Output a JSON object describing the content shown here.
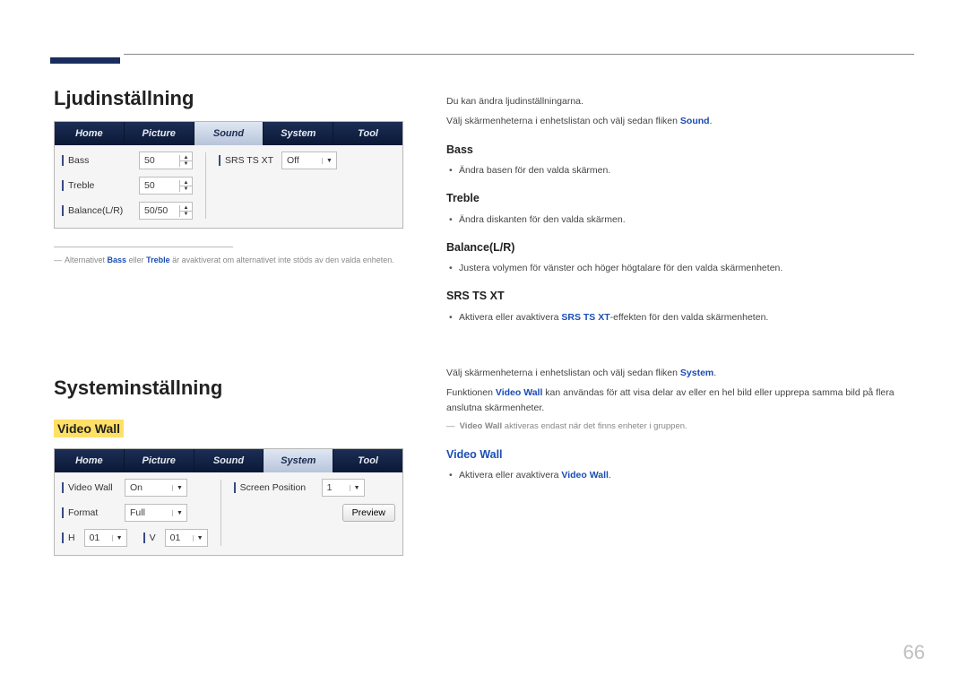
{
  "pageNumber": "66",
  "sound": {
    "title": "Ljudinställning",
    "tabs": [
      "Home",
      "Picture",
      "Sound",
      "System",
      "Tool"
    ],
    "activeTab": "Sound",
    "bassLabel": "Bass",
    "bassVal": "50",
    "trebleLabel": "Treble",
    "trebleVal": "50",
    "balanceLabel": "Balance(L/R)",
    "balanceVal": "50/50",
    "srsLabel": "SRS TS XT",
    "srsVal": "Off",
    "footnote": {
      "dash": "―",
      "pre": "Alternativet ",
      "b1": "Bass",
      "mid": " eller ",
      "b2": "Treble",
      "post": " är avaktiverat om alternativet inte stöds av den valda enheten."
    }
  },
  "soundRight": {
    "intro1": "Du kan ändra ljudinställningarna.",
    "intro2a": "Välj skärmenheterna i enhetslistan och välj sedan fliken ",
    "intro2b": "Sound",
    "intro2c": ".",
    "bassHeading": "Bass",
    "bassItem": "Ändra basen för den valda skärmen.",
    "trebleHeading": "Treble",
    "trebleItem": "Ändra diskanten för den valda skärmen.",
    "balanceHeading": "Balance(L/R)",
    "balanceItem": "Justera volymen för vänster och höger högtalare för den valda skärmenheten.",
    "srsHeading": "SRS TS XT",
    "srsItemPre": "Aktivera eller avaktivera ",
    "srsItemB": "SRS TS XT",
    "srsItemPost": "-effekten för den valda skärmenheten."
  },
  "system": {
    "title": "Systeminställning",
    "videoWallLabel": "Video Wall",
    "tabs": [
      "Home",
      "Picture",
      "Sound",
      "System",
      "Tool"
    ],
    "activeTab": "System",
    "vwLabel": "Video Wall",
    "vwVal": "On",
    "fmtLabel": "Format",
    "fmtVal": "Full",
    "hLabel": "H",
    "hVal": "01",
    "vLabel": "V",
    "vVal": "01",
    "spLabel": "Screen Position",
    "spVal": "1",
    "previewBtn": "Preview"
  },
  "systemRight": {
    "intro1a": "Välj skärmenheterna i enhetslistan och välj sedan fliken ",
    "intro1b": "System",
    "intro1c": ".",
    "fnPre": "Funktionen ",
    "fnB": "Video Wall",
    "fnPost": " kan användas för att visa delar av eller en hel bild eller upprepa samma bild på flera anslutna skärmenheter.",
    "noteDash": "―",
    "noteB": "Video Wall",
    "notePost": " aktiveras endast när det finns enheter i gruppen.",
    "vwHeading": "Video Wall",
    "vwItemPre": "Aktivera eller avaktivera ",
    "vwItemB": "Video Wall",
    "vwItemPost": "."
  }
}
